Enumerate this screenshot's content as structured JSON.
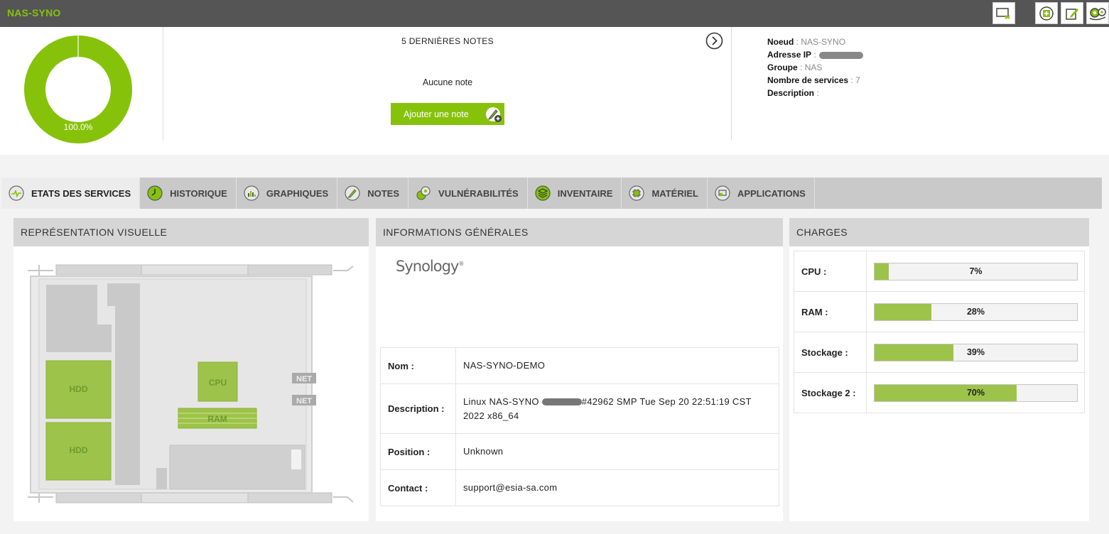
{
  "header": {
    "title": "NAS-SYNO",
    "buttons": [
      {
        "name": "monitor-add-button",
        "icon": "monitor-plus-icon"
      },
      {
        "name": "add-service-button",
        "icon": "plus-box-icon"
      },
      {
        "name": "edit-button",
        "icon": "edit-icon"
      },
      {
        "name": "settings-button",
        "icon": "gears-icon"
      }
    ]
  },
  "summary": {
    "availability": {
      "value": 100.0,
      "label": "100.0%",
      "color": "#86c20a"
    },
    "notes": {
      "title": "5 DERNIÈRES NOTES",
      "empty": "Aucune note",
      "add_label": "Ajouter une note"
    },
    "node_info": {
      "node_key": "Noeud",
      "node_val": "NAS-SYNO",
      "ip_key": "Adresse IP",
      "group_key": "Groupe",
      "group_val": "NAS",
      "services_key": "Nombre de services",
      "services_val": "7",
      "desc_key": "Description",
      "desc_val": ""
    }
  },
  "tabs": [
    {
      "label": "ETATS DES SERVICES",
      "icon": "heartbeat-icon",
      "active": true
    },
    {
      "label": "HISTORIQUE",
      "icon": "clock-icon"
    },
    {
      "label": "GRAPHIQUES",
      "icon": "bar-chart-icon"
    },
    {
      "label": "NOTES",
      "icon": "pencil-icon"
    },
    {
      "label": "VULNÉRABILITÉS",
      "icon": "vulnerability-icon"
    },
    {
      "label": "INVENTAIRE",
      "icon": "stack-icon"
    },
    {
      "label": "MATÉRIEL",
      "icon": "chip-icon"
    },
    {
      "label": "APPLICATIONS",
      "icon": "applications-icon"
    }
  ],
  "visual": {
    "title": "REPRÉSENTATION VISUELLE",
    "hdd1": "HDD",
    "hdd2": "HDD",
    "cpu": "CPU",
    "ram": "RAM",
    "net1": "NET",
    "net2": "NET"
  },
  "general": {
    "title": "INFORMATIONS GÉNÉRALES",
    "logo": "Synology",
    "rows": [
      {
        "key": "Nom :",
        "value": "NAS-SYNO-DEMO"
      },
      {
        "key": "Description :",
        "value_prefix": "Linux NAS-SYNO",
        "value_suffix": "#42962 SMP Tue Sep 20 22:51:19 CST 2022 x86_64"
      },
      {
        "key": "Position :",
        "value": "Unknown"
      },
      {
        "key": "Contact :",
        "value": "support@esia-sa.com"
      }
    ]
  },
  "charges": {
    "title": "CHARGES",
    "rows": [
      {
        "label": "CPU :",
        "value": 7,
        "display": "7%"
      },
      {
        "label": "RAM :",
        "value": 28,
        "display": "28%"
      },
      {
        "label": "Stockage :",
        "value": 39,
        "display": "39%"
      },
      {
        "label": "Stockage 2 :",
        "value": 70,
        "display": "70%"
      }
    ]
  }
}
